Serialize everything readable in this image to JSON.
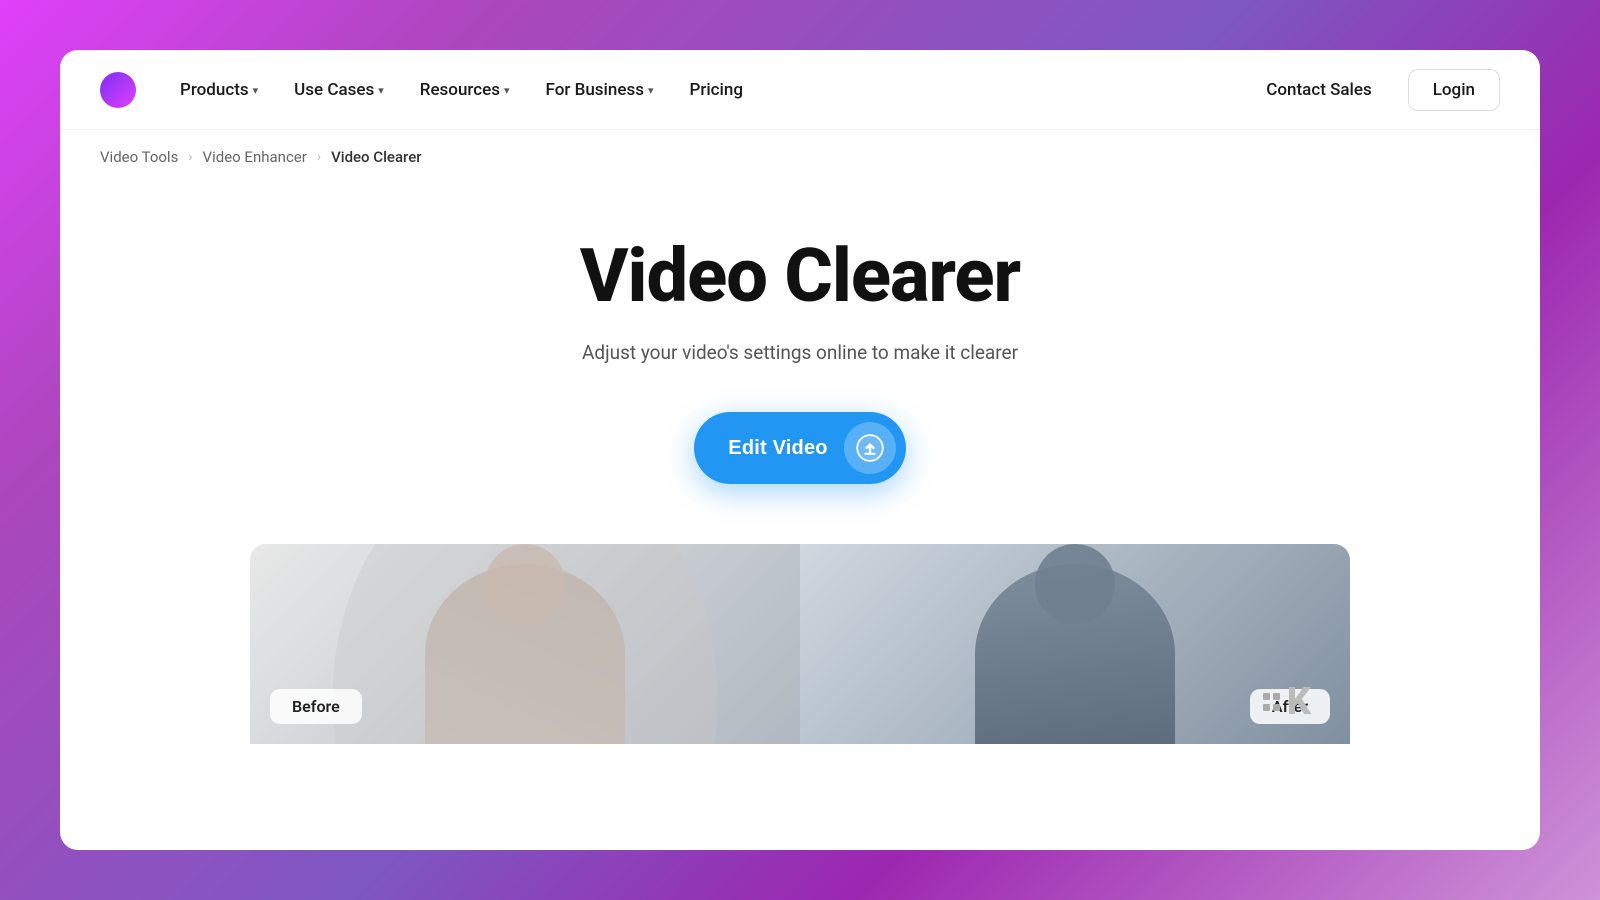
{
  "page": {
    "title": "Video Clearer",
    "subtitle": "Adjust your video's settings online to make it clearer"
  },
  "navbar": {
    "nav_items": [
      {
        "label": "Products",
        "has_chevron": true
      },
      {
        "label": "Use Cases",
        "has_chevron": true
      },
      {
        "label": "Resources",
        "has_chevron": true
      },
      {
        "label": "For Business",
        "has_chevron": true
      },
      {
        "label": "Pricing",
        "has_chevron": false
      }
    ],
    "contact_sales": "Contact Sales",
    "login": "Login"
  },
  "breadcrumb": {
    "items": [
      {
        "label": "Video Tools"
      },
      {
        "label": "Video Enhancer"
      },
      {
        "label": "Video Clearer"
      }
    ]
  },
  "hero": {
    "cta_button": "Edit Video",
    "before_label": "Before",
    "after_label": "After"
  }
}
